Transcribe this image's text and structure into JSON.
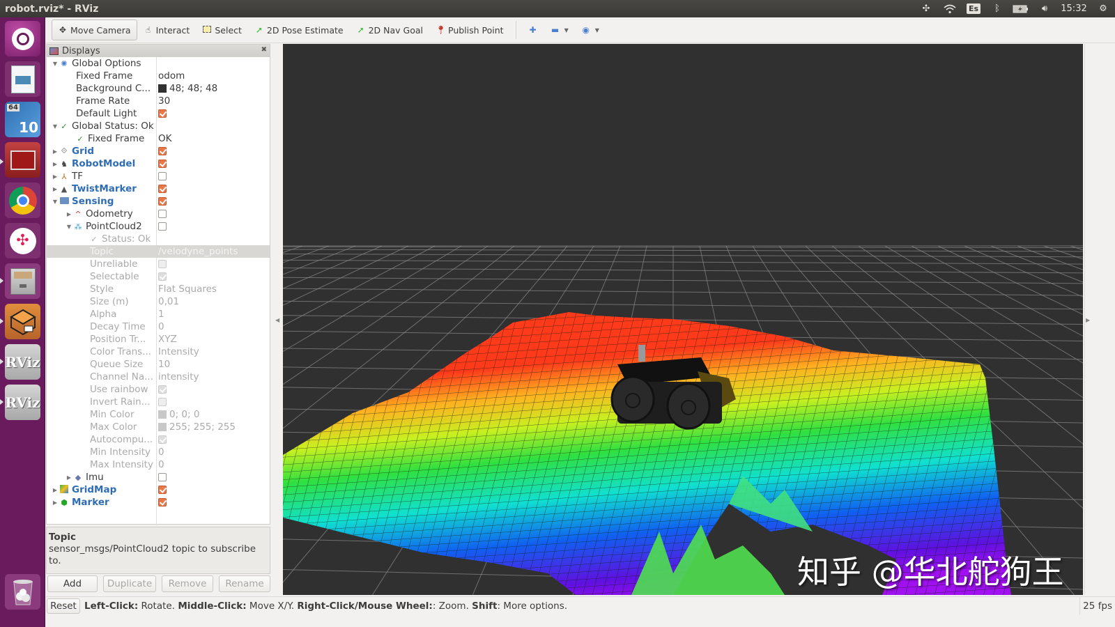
{
  "window": {
    "title": "robot.rviz* - RViz"
  },
  "tray": {
    "slack_icon": "slack-icon",
    "wifi_icon": "wifi-icon",
    "keyboard_layout": "Es",
    "bluetooth_icon": "bluetooth-icon",
    "battery_icon": "battery-charging-icon",
    "volume_icon": "volume-icon",
    "time": "15:32",
    "power_icon": "power-gear-icon"
  },
  "launcher": {
    "items": [
      {
        "name": "ubuntu-dash",
        "label": ""
      },
      {
        "name": "libreoffice-impress",
        "label": ""
      },
      {
        "name": "virtualbox-64-10",
        "label": "10"
      },
      {
        "name": "terminal-red",
        "label": ""
      },
      {
        "name": "chrome",
        "label": ""
      },
      {
        "name": "slack",
        "label": ""
      },
      {
        "name": "file-cabinet",
        "label": ""
      },
      {
        "name": "package-box",
        "label": ""
      },
      {
        "name": "rviz-1",
        "label": "RViz"
      },
      {
        "name": "rviz-2",
        "label": "RViz"
      },
      {
        "name": "trash",
        "label": ""
      }
    ]
  },
  "toolbar": {
    "move_camera": "Move Camera",
    "interact": "Interact",
    "select": "Select",
    "pose_estimate": "2D Pose Estimate",
    "nav_goal": "2D Nav Goal",
    "publish_point": "Publish Point"
  },
  "displays": {
    "title": "Displays",
    "rows": [
      {
        "name": "Global Options",
        "value": ""
      },
      {
        "name": "Fixed Frame",
        "value": "odom"
      },
      {
        "name": "Background C...",
        "value": "48; 48; 48",
        "swatch": "#303030"
      },
      {
        "name": "Frame Rate",
        "value": "30"
      },
      {
        "name": "Default Light",
        "checked": true
      },
      {
        "name": "Global Status: Ok",
        "value": ""
      },
      {
        "name": "Fixed Frame",
        "value": "OK"
      },
      {
        "name": "Grid",
        "checked": true
      },
      {
        "name": "RobotModel",
        "checked": true
      },
      {
        "name": "TF",
        "checked": false
      },
      {
        "name": "TwistMarker",
        "checked": true
      },
      {
        "name": "Sensing",
        "checked": true
      },
      {
        "name": "Odometry",
        "checked": false
      },
      {
        "name": "PointCloud2",
        "checked": false
      },
      {
        "name": "Status: Ok",
        "value": ""
      },
      {
        "name": "Topic",
        "value": "/velodyne_points"
      },
      {
        "name": "Unreliable",
        "checked": false
      },
      {
        "name": "Selectable",
        "checked": true
      },
      {
        "name": "Style",
        "value": "Flat Squares"
      },
      {
        "name": "Size (m)",
        "value": "0,01"
      },
      {
        "name": "Alpha",
        "value": "1"
      },
      {
        "name": "Decay Time",
        "value": "0"
      },
      {
        "name": "Position Tr...",
        "value": "XYZ"
      },
      {
        "name": "Color Trans...",
        "value": "Intensity"
      },
      {
        "name": "Queue Size",
        "value": "10"
      },
      {
        "name": "Channel Na...",
        "value": "intensity"
      },
      {
        "name": "Use rainbow",
        "checked": true
      },
      {
        "name": "Invert Rain...",
        "checked": false
      },
      {
        "name": "Min Color",
        "value": "0; 0; 0",
        "swatch": "#c8c8c8"
      },
      {
        "name": "Max Color",
        "value": "255; 255; 255",
        "swatch": "#c8c8c8"
      },
      {
        "name": "Autocompu...",
        "checked": true
      },
      {
        "name": "Min Intensity",
        "value": "0"
      },
      {
        "name": "Max Intensity",
        "value": "0"
      },
      {
        "name": "Imu",
        "checked": false
      },
      {
        "name": "GridMap",
        "checked": true
      },
      {
        "name": "Marker",
        "checked": true
      }
    ]
  },
  "help": {
    "title": "Topic",
    "text": "sensor_msgs/PointCloud2 topic to subscribe to."
  },
  "buttons": {
    "add": "Add",
    "duplicate": "Duplicate",
    "remove": "Remove",
    "rename": "Rename"
  },
  "status": {
    "reset": "Reset",
    "parts": [
      {
        "b": "Left-Click:",
        "t": " Rotate. "
      },
      {
        "b": "Middle-Click:",
        "t": " Move X/Y. "
      },
      {
        "b": "Right-Click/Mouse Wheel:",
        "t": ": Zoom. "
      },
      {
        "b": "Shift",
        "t": ": More options."
      }
    ],
    "fps": "25 fps"
  },
  "viewport": {
    "background": "#303030",
    "watermark": "知乎 @华北舵狗王"
  },
  "colors": {
    "accent_checkbox": "#e8774a",
    "launcher_bg": "#6a1b5d",
    "display_name_blue": "#2e6db4"
  }
}
